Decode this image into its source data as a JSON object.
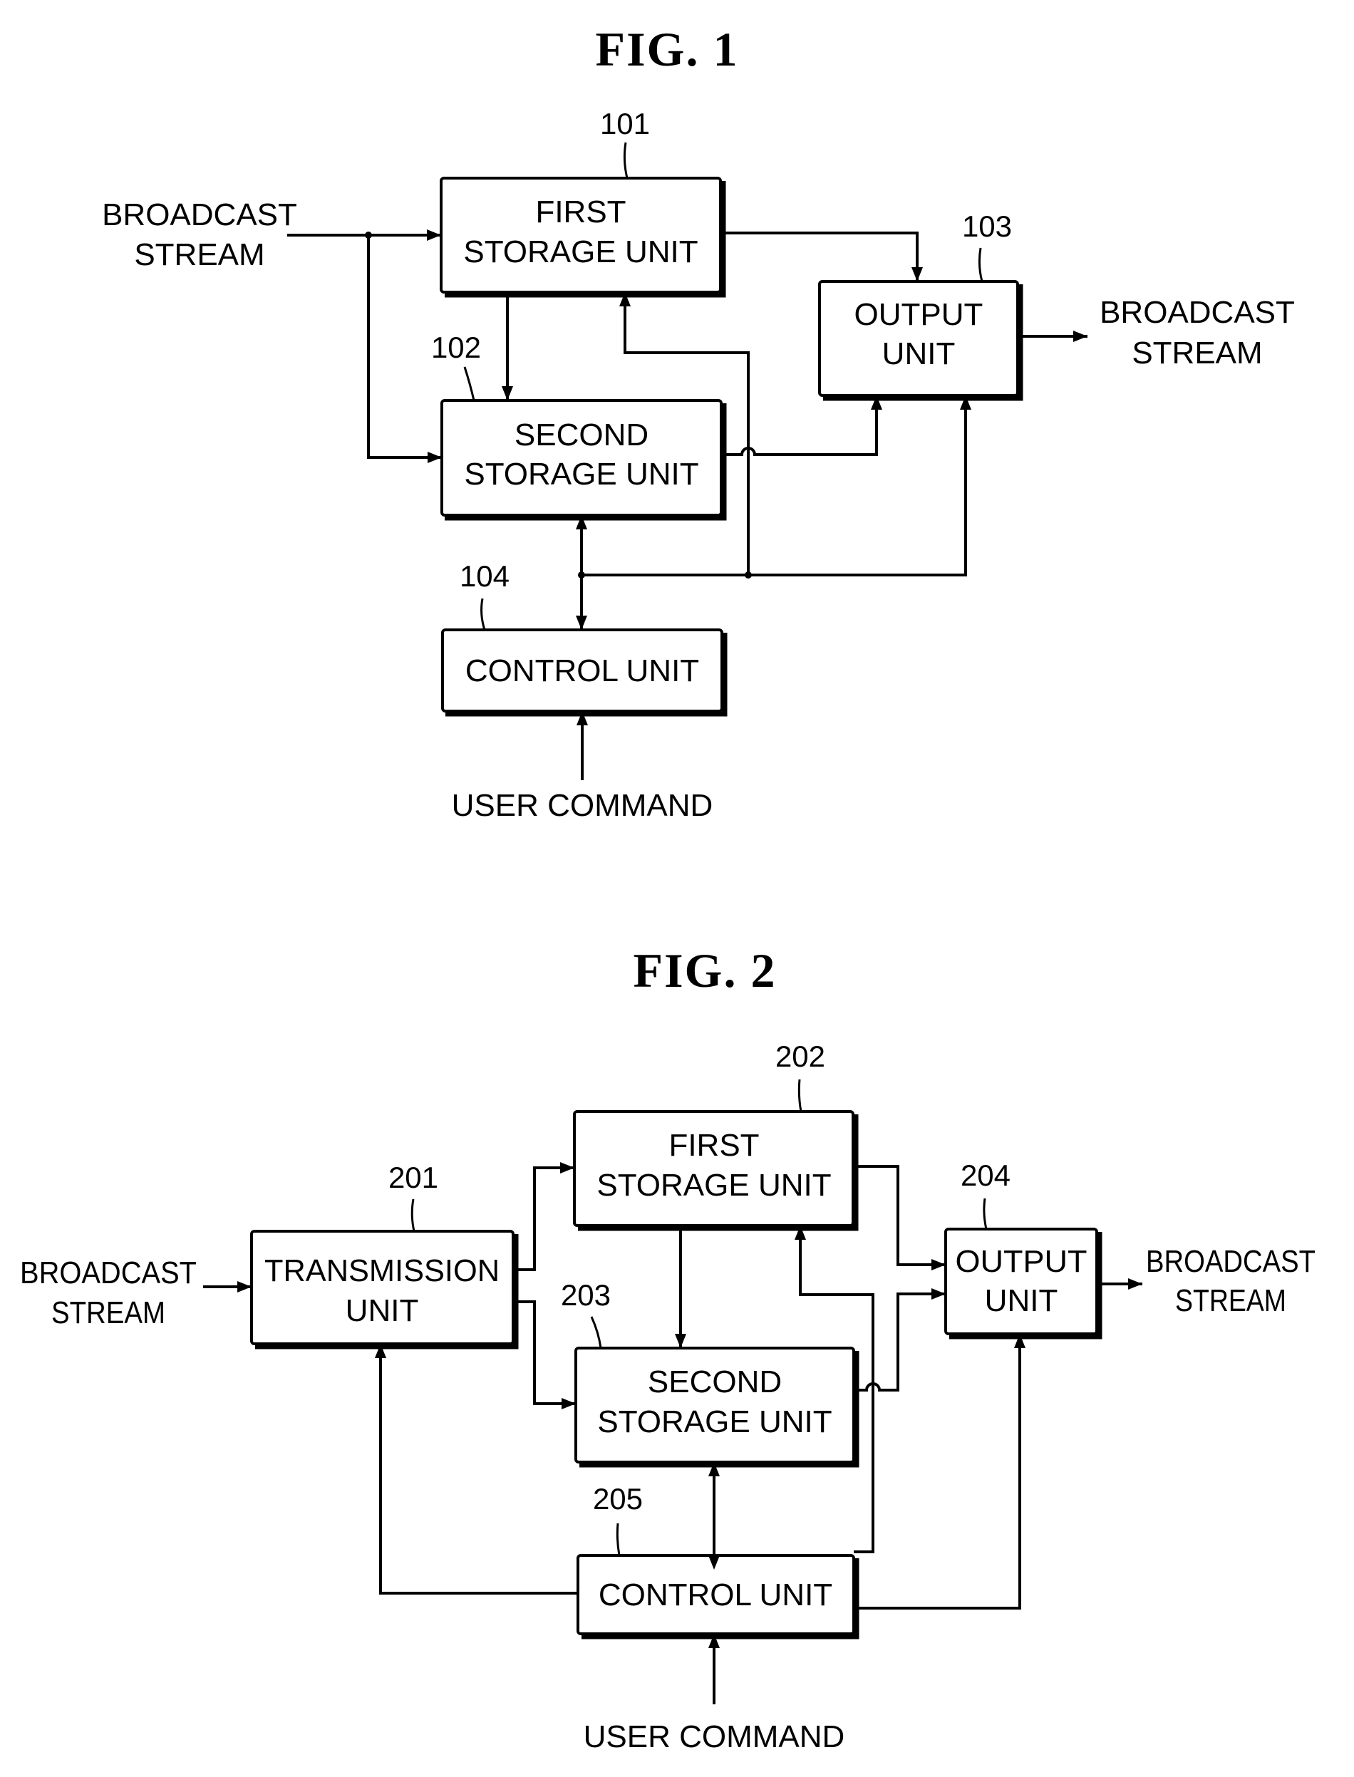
{
  "figures": [
    {
      "title": "FIG.  1",
      "input_label": [
        "BROADCAST",
        "STREAM"
      ],
      "output_label": [
        "BROADCAST",
        "STREAM"
      ],
      "user_command": "USER COMMAND",
      "blocks": {
        "first_storage": {
          "ref": "101",
          "lines": [
            "FIRST",
            "STORAGE UNIT"
          ]
        },
        "second_storage": {
          "ref": "102",
          "lines": [
            "SECOND",
            "STORAGE UNIT"
          ]
        },
        "output": {
          "ref": "103",
          "lines": [
            "OUTPUT",
            "UNIT"
          ]
        },
        "control": {
          "ref": "104",
          "lines": [
            "CONTROL UNIT"
          ]
        }
      }
    },
    {
      "title": "FIG.  2",
      "input_label": [
        "BROADCAST",
        "STREAM"
      ],
      "output_label": [
        "BROADCAST",
        "STREAM"
      ],
      "user_command": "USER COMMAND",
      "blocks": {
        "transmission": {
          "ref": "201",
          "lines": [
            "TRANSMISSION",
            "UNIT"
          ]
        },
        "first_storage": {
          "ref": "202",
          "lines": [
            "FIRST",
            "STORAGE UNIT"
          ]
        },
        "second_storage": {
          "ref": "203",
          "lines": [
            "SECOND",
            "STORAGE UNIT"
          ]
        },
        "output": {
          "ref": "204",
          "lines": [
            "OUTPUT",
            "UNIT"
          ]
        },
        "control": {
          "ref": "205",
          "lines": [
            "CONTROL UNIT"
          ]
        }
      }
    }
  ]
}
